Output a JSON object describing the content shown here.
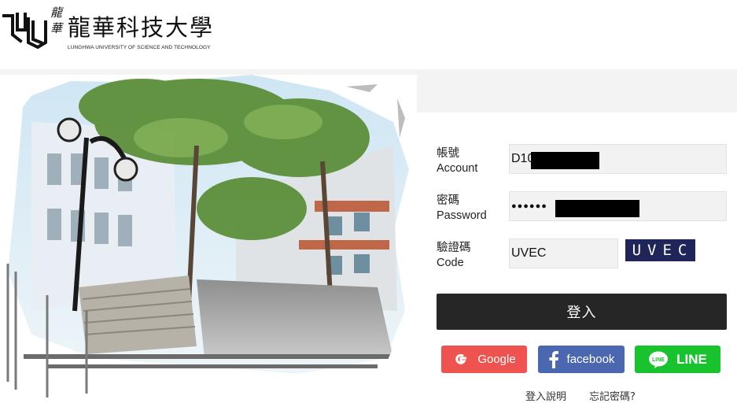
{
  "header": {
    "school_name": "龍華科技大學",
    "school_name_vertical": "龍華",
    "school_name_en": "LUNGHWA UNIVERSITY OF SCIENCE AND TECHNOLOGY"
  },
  "form": {
    "account_label_zh": "帳號",
    "account_label_en": "Account",
    "account_value": "D10",
    "password_label_zh": "密碼",
    "password_label_en": "Password",
    "password_value": "●●●●●●",
    "code_label_zh": "驗證碼",
    "code_label_en": "Code",
    "code_value": "UVEC",
    "captcha_text": "UVEC",
    "login_label": "登入"
  },
  "social": {
    "google_label": "Google",
    "facebook_label": "facebook",
    "line_label": "LINE"
  },
  "links": {
    "help_label": "登入說明",
    "forgot_label": "忘記密碼?"
  },
  "colors": {
    "login_button": "#262626",
    "google": "#ef5350",
    "facebook": "#4a67b0",
    "line": "#18c32e",
    "captcha_bg": "#1f2559"
  }
}
